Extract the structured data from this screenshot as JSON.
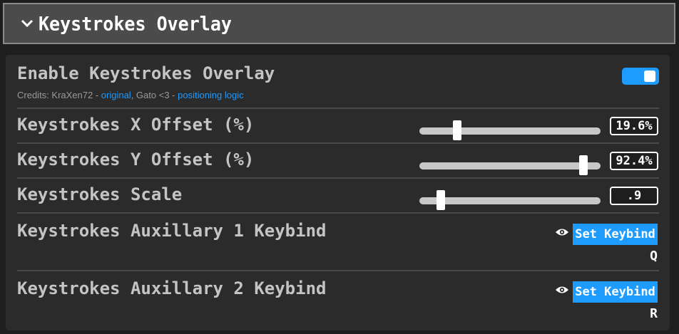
{
  "header": {
    "title": "Keystrokes Overlay",
    "chevron_icon": "chevron-down-icon"
  },
  "settings": {
    "enable": {
      "label": "Enable Keystrokes Overlay",
      "enabled": true,
      "credits": {
        "prefix": "Credits: KraXen72 - ",
        "link1": "original",
        "middle": ", Gato <3 - ",
        "link2": "positioning logic"
      }
    },
    "x_offset": {
      "label": "Keystrokes X Offset (%)",
      "value": "19.6%",
      "fraction": 0.196
    },
    "y_offset": {
      "label": "Keystrokes Y Offset (%)",
      "value": "92.4%",
      "fraction": 0.924
    },
    "scale": {
      "label": "Keystrokes Scale",
      "value": ".9",
      "fraction": 0.1
    },
    "aux1": {
      "label": "Keystrokes Auxillary 1 Keybind",
      "button": "Set Keybind",
      "key": "Q",
      "icon": "eye-icon"
    },
    "aux2": {
      "label": "Keystrokes Auxillary 2 Keybind",
      "button": "Set Keybind",
      "key": "R",
      "icon": "eye-icon"
    }
  },
  "colors": {
    "accent": "#1e9bff",
    "panel": "#2b2b2b",
    "header": "#4b4b4b"
  }
}
